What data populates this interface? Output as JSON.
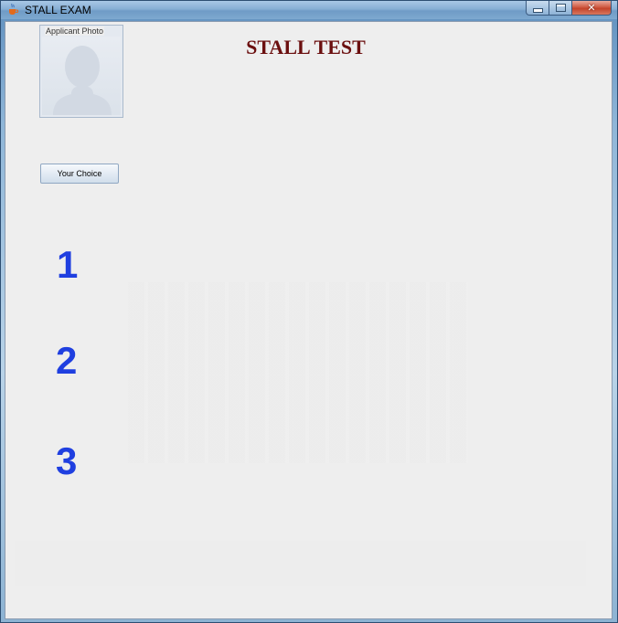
{
  "window": {
    "title": "STALL EXAM"
  },
  "header": {
    "title": "STALL TEST"
  },
  "photo": {
    "label": "Applicant Photo"
  },
  "choice_button": {
    "label": "Your Choice"
  },
  "numbers": [
    "1",
    "2",
    "3"
  ],
  "colors": {
    "title": "#6b0f0f",
    "numbers": "#1f3fe0",
    "client_bg": "#eeeeee"
  }
}
